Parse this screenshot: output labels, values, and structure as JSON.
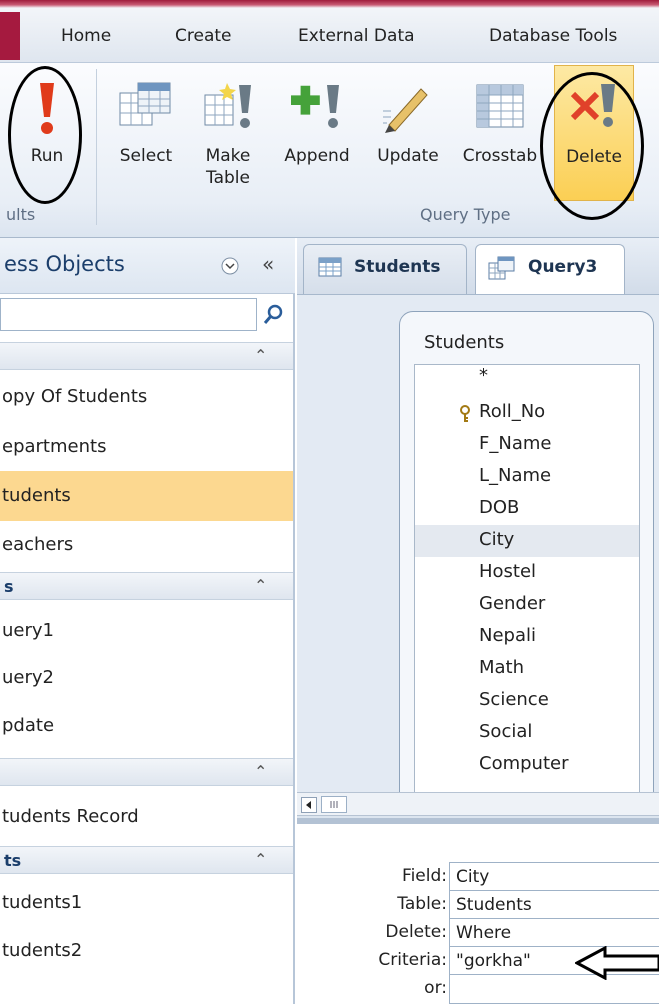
{
  "ribbon_tabs": [
    "Home",
    "Create",
    "External Data",
    "Database Tools"
  ],
  "ribbon": {
    "run_label": "Run",
    "results_group": "ults",
    "select_label": "Select",
    "make_table_label_1": "Make",
    "make_table_label_2": "Table",
    "append_label": "Append",
    "update_label": "Update",
    "crosstab_label": "Crosstab",
    "delete_label": "Delete",
    "query_type_group": "Query Type"
  },
  "nav": {
    "title": "ess Objects",
    "sections": [
      {
        "label": "",
        "items": [
          "opy Of Students",
          "epartments",
          "tudents",
          "eachers"
        ]
      },
      {
        "label": "s",
        "items": [
          "uery1",
          "uery2",
          "pdate"
        ]
      },
      {
        "label": "",
        "items": [
          "tudents Record"
        ]
      },
      {
        "label": "ts",
        "items": [
          "tudents1",
          "tudents2"
        ]
      }
    ],
    "selected_item": "tudents"
  },
  "doc_tabs": [
    "Students",
    "Query3"
  ],
  "table_box": {
    "title": "Students",
    "fields": [
      "*",
      "Roll_No",
      "F_Name",
      "L_Name",
      "DOB",
      "City",
      "Hostel",
      "Gender",
      "Nepali",
      "Math",
      "Science",
      "Social",
      "Computer"
    ],
    "highlighted": "City"
  },
  "grid": {
    "labels": {
      "field": "Field:",
      "table": "Table:",
      "delete": "Delete:",
      "criteria": "Criteria:",
      "or": "or:"
    },
    "values": {
      "field": "City",
      "table": "Students",
      "delete": "Where",
      "criteria": "\"gorkha\"",
      "or": ""
    }
  },
  "colors": {
    "accent_red": "#a51a3f",
    "selected_item": "#fcd890",
    "delete_highlight": "#fbd15b"
  }
}
